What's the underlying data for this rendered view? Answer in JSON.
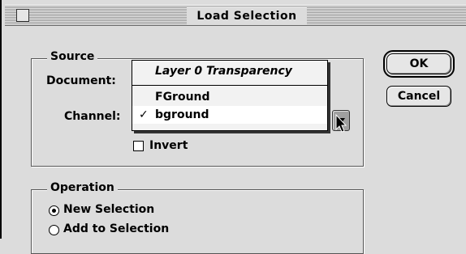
{
  "dialog": {
    "title": "Load Selection"
  },
  "source": {
    "group_label": "Source",
    "document_label": "Document:",
    "channel_label": "Channel:",
    "invert_label": "Invert",
    "invert_checked": false
  },
  "channel_menu": {
    "items": [
      {
        "label": "Layer 0 Transparency",
        "italic": true
      },
      {
        "label": "FGround",
        "checked": false
      },
      {
        "label": "bground",
        "checked": true
      }
    ],
    "check_mark": "✓"
  },
  "buttons": {
    "ok": "OK",
    "cancel": "Cancel"
  },
  "operation": {
    "group_label": "Operation",
    "options": [
      {
        "label": "New Selection",
        "selected": true
      },
      {
        "label": "Add to Selection",
        "selected": false
      }
    ]
  }
}
